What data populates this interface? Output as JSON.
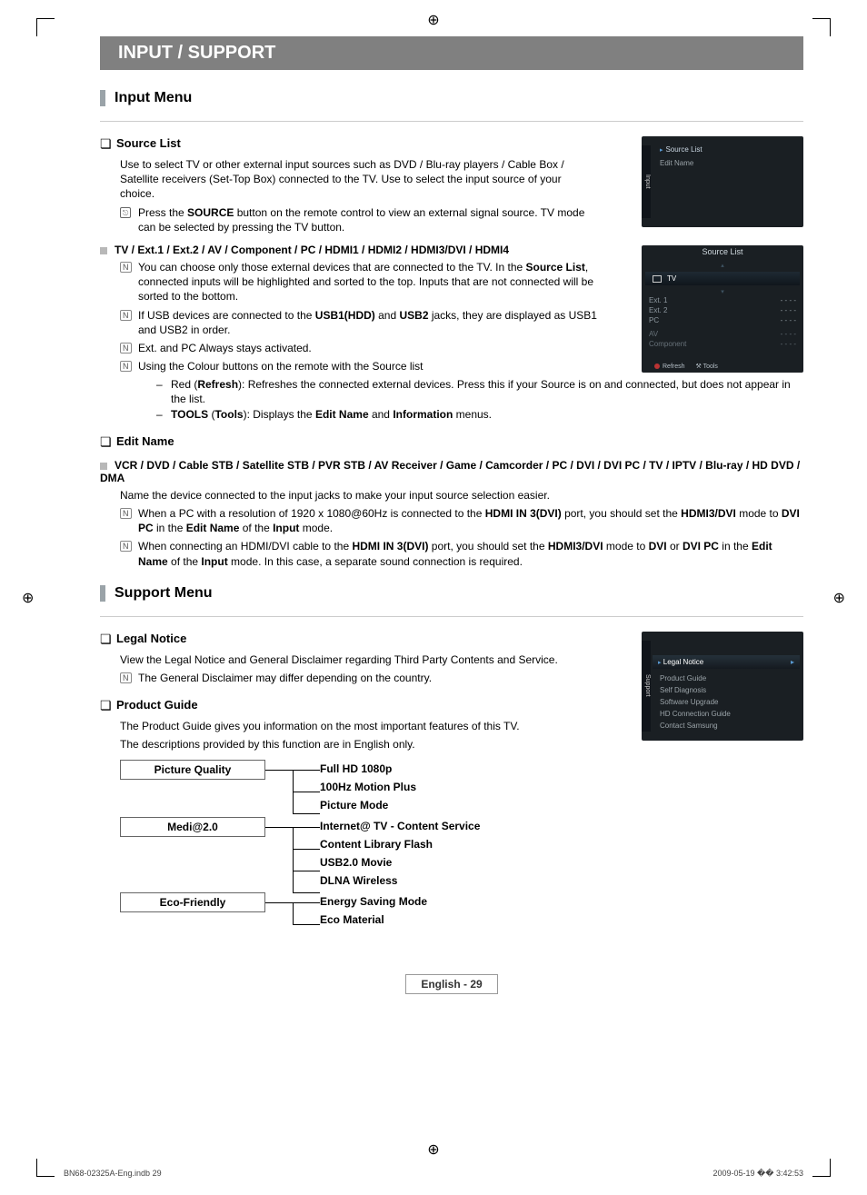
{
  "band": "INPUT / SUPPORT",
  "input_menu": {
    "title": "Input Menu",
    "source_list": {
      "h": "Source List",
      "p1": "Use to select TV or other external input sources such as DVD / Blu-ray players / Cable Box / Satellite receivers (Set-Top Box) connected to the TV. Use to select the input source of your choice.",
      "remote_pre": "Press the ",
      "remote_b": "SOURCE",
      "remote_post": " button on the remote control to view an external signal source. TV mode can be selected by pressing the TV button.",
      "sub_h": "TV / Ext.1 / Ext.2 / AV / Component / PC / HDMI1 / HDMI2 / HDMI3/DVI / HDMI4",
      "n1_pre": "You can choose only those external devices that are connected to the TV. In the ",
      "n1_b": "Source List",
      "n1_post": ", connected inputs will be highlighted and sorted to the top. Inputs that are not connected will be sorted to the bottom.",
      "n2_pre": "If USB devices are connected to the ",
      "n2_b1": "USB1(HDD)",
      "n2_mid": " and ",
      "n2_b2": "USB2",
      "n2_post": " jacks, they are displayed as USB1 and USB2 in order.",
      "n3": "Ext. and PC Always stays activated.",
      "n4": "Using the Colour buttons on the remote with the Source list",
      "d1_pre": "Red (",
      "d1_b": "Refresh",
      "d1_post": "): Refreshes the connected external devices. Press this if your Source is on and connected, but does not appear in the list.",
      "d2_b1": "TOOLS",
      "d2_mid1": " (",
      "d2_b2": "Tools",
      "d2_mid2": "): Displays the ",
      "d2_b3": "Edit Name",
      "d2_mid3": " and ",
      "d2_b4": "Information",
      "d2_post": " menus."
    },
    "edit_name": {
      "h": "Edit Name",
      "sub_h": "VCR / DVD / Cable STB / Satellite STB / PVR STB / AV Receiver / Game / Camcorder / PC / DVI / DVI PC / TV / IPTV / Blu-ray / HD DVD / DMA",
      "p1": "Name the device connected to the input jacks to make your input source selection easier.",
      "n1_pre": "When a PC with a resolution of 1920 x 1080@60Hz is connected to the ",
      "n1_b1": "HDMI IN 3(DVI)",
      "n1_mid1": " port, you should set the ",
      "n1_b2": "HDMI3/DVI",
      "n1_mid2": " mode to ",
      "n1_b3": "DVI PC",
      "n1_mid3": " in the ",
      "n1_b4": "Edit Name",
      "n1_mid4": " of the ",
      "n1_b5": "Input",
      "n1_post": " mode.",
      "n2_pre": "When connecting an HDMI/DVI cable to the ",
      "n2_b1": "HDMI IN 3(DVI)",
      "n2_mid1": " port, you should set the ",
      "n2_b2": "HDMI3/DVI",
      "n2_mid2": " mode to ",
      "n2_b3": "DVI",
      "n2_mid3": " or ",
      "n2_b4": "DVI PC",
      "n2_mid4": " in the ",
      "n2_b5": "Edit Name",
      "n2_mid5": " of the ",
      "n2_b6": "Input",
      "n2_post": " mode. In this case, a separate sound connection is required."
    }
  },
  "support_menu": {
    "title": "Support Menu",
    "legal": {
      "h": "Legal Notice",
      "p1": "View the Legal Notice and General Disclaimer regarding Third Party Contents and Service.",
      "n1": "The General Disclaimer may differ depending on the country."
    },
    "product_guide": {
      "h": "Product Guide",
      "p1": "The Product Guide gives you information on the most important features of this TV.",
      "p2": "The descriptions provided by this function are in English only.",
      "tree": [
        {
          "box": "Picture Quality",
          "leaves": [
            "Full HD 1080p",
            "100Hz Motion Plus",
            "Picture Mode"
          ]
        },
        {
          "box": "Medi@2.0",
          "leaves": [
            "Internet@ TV - Content Service",
            "Content Library Flash",
            "USB2.0 Movie",
            "DLNA Wireless"
          ]
        },
        {
          "box": "Eco-Friendly",
          "leaves": [
            "Energy Saving Mode",
            "Eco Material"
          ]
        }
      ]
    }
  },
  "tv1": {
    "side": "Input",
    "title": "Source List",
    "items": [
      "Edit Name"
    ]
  },
  "tv2": {
    "title": "Source List",
    "sel": "TV",
    "rows": [
      {
        "l": "Ext. 1",
        "r": "- - - -"
      },
      {
        "l": "Ext. 2",
        "r": "- - - -"
      },
      {
        "l": "PC",
        "r": "- - - -"
      },
      {
        "l": "AV",
        "r": "- - - -"
      },
      {
        "l": "Component",
        "r": "- - - -"
      }
    ],
    "foot_refresh": "Refresh",
    "foot_tools": "Tools"
  },
  "tv3": {
    "side": "Support",
    "sel": "Legal Notice",
    "items": [
      "Product Guide",
      "Self Diagnosis",
      "Software Upgrade",
      "HD Connection Guide",
      "Contact Samsung"
    ]
  },
  "page_label": "English - 29",
  "footer_left": "BN68-02325A-Eng.indb   29",
  "footer_right": "2009-05-19   �� 3:42:53"
}
